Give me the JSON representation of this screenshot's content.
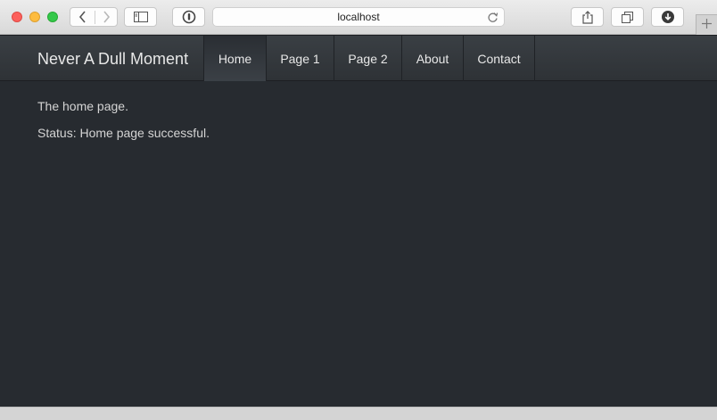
{
  "browser": {
    "address": "localhost",
    "icons": {
      "back": "chevron-left-icon",
      "forward": "chevron-right-icon",
      "sidebar": "sidebar-icon",
      "extension": "password-manager-icon",
      "reload": "reload-icon",
      "share": "share-icon",
      "tabs": "tab-overview-icon",
      "downloads": "download-icon",
      "new_tab": "plus-icon"
    }
  },
  "navbar": {
    "brand": "Never A Dull Moment",
    "items": [
      {
        "label": "Home",
        "active": true
      },
      {
        "label": "Page 1",
        "active": false
      },
      {
        "label": "Page 2",
        "active": false
      },
      {
        "label": "About",
        "active": false
      },
      {
        "label": "Contact",
        "active": false
      }
    ]
  },
  "main": {
    "intro": "The home page.",
    "status": "Status: Home page successful."
  },
  "colors": {
    "page_background": "#272b30",
    "navbar_background": "#3a3f44",
    "text": "#d4d4d4"
  }
}
